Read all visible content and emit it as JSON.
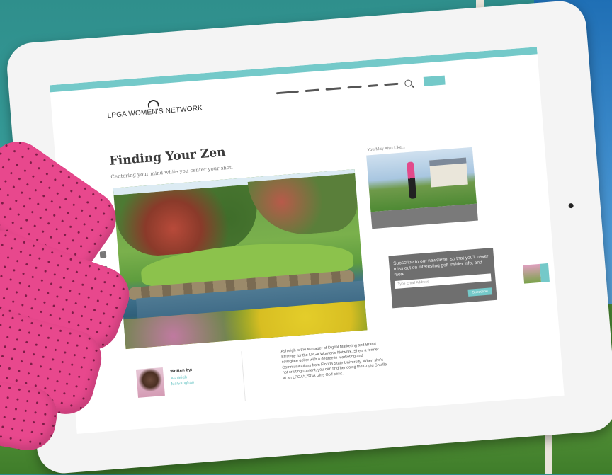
{
  "site": {
    "logo_text": "LPGA WOMEN'S NETWORK",
    "nav_items": [
      "",
      "",
      "",
      "",
      "",
      ""
    ],
    "accent_color": "#74c9c9"
  },
  "article": {
    "title": "Finding Your Zen",
    "subtitle": "Centering your mind while you center your shot."
  },
  "social_icons": [
    "facebook-icon",
    "twitter-icon",
    "instagram-icon",
    "email-icon"
  ],
  "author": {
    "written_by_label": "Written by:",
    "name": "Ashleigh McGaughan",
    "bio": "Ashleigh is the Manager of Digital Marketing and Brand Strategy for the LPGA Women's Network. She's a former collegiate golfer with a degree in Marketing and Communications from Florida State University. When she's not crafting content, you can find her doing the Cupid Shuffle at an LPGA*USGA Girls Golf clinic."
  },
  "sidebar": {
    "title": "You May Also Like..."
  },
  "newsletter": {
    "message": "Subscribe to our newsletter so that you'll never miss out on interesting golf insider info, and more.",
    "email_placeholder": "Type Email Address",
    "submit_label": "Subscribe"
  }
}
